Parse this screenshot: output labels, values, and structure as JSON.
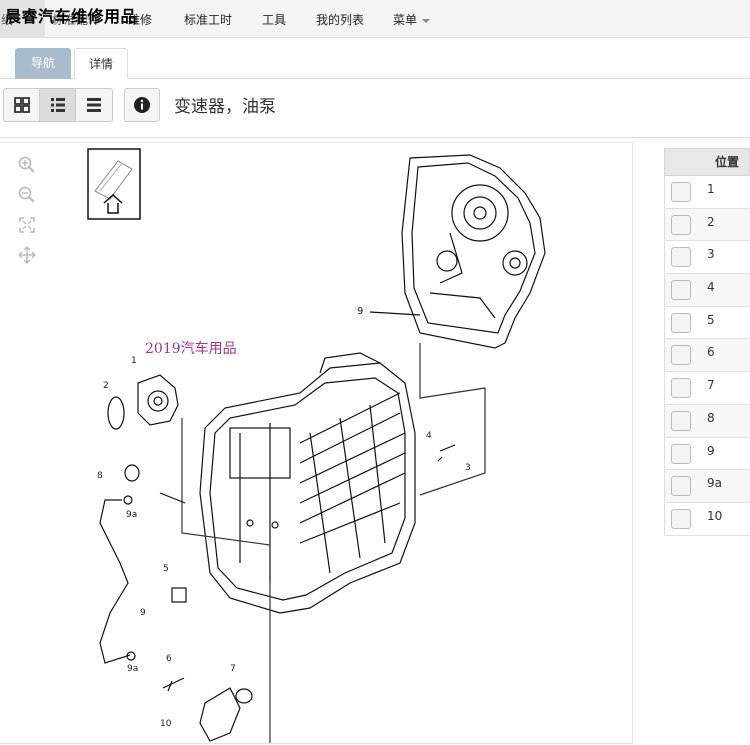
{
  "watermark": "晨睿汽车维修用品",
  "topnav": {
    "items": [
      {
        "label": "标准工时"
      },
      {
        "label": "工具"
      },
      {
        "label": "我的列表"
      },
      {
        "label": "菜单"
      }
    ],
    "partial": [
      "纸",
      "标准配件",
      "维修"
    ]
  },
  "tabs": [
    {
      "label": "导航"
    },
    {
      "label": "详情"
    }
  ],
  "page": {
    "title": "变速器，油泵"
  },
  "diagram": {
    "watermark_text": "2019汽车用品",
    "callouts": [
      "1",
      "2",
      "3",
      "4",
      "5",
      "6",
      "7",
      "8",
      "9",
      "9",
      "9",
      "9a",
      "9a",
      "10"
    ]
  },
  "parts_table": {
    "header": "位置",
    "rows": [
      "1",
      "2",
      "3",
      "4",
      "5",
      "6",
      "7",
      "8",
      "9",
      "9a",
      "10"
    ]
  },
  "colors": {
    "tab_active": "#a8bccd",
    "watermark_pink": "#a8338c"
  }
}
